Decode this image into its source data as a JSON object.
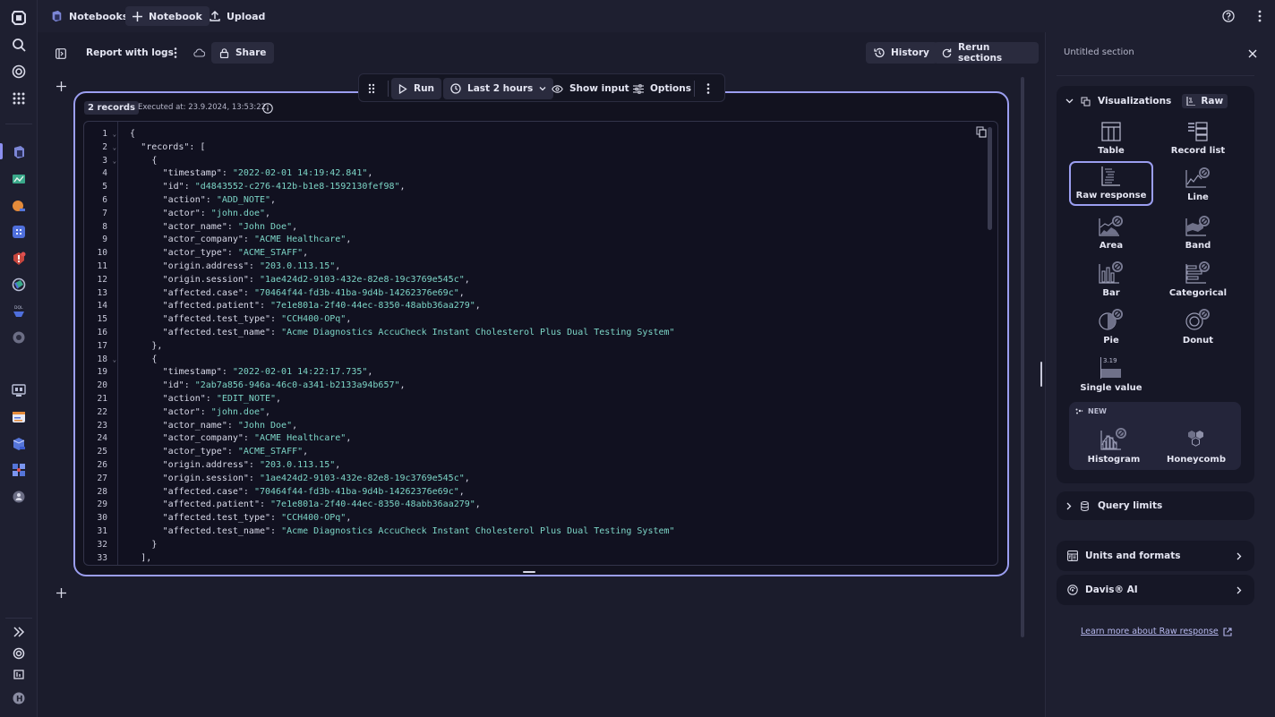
{
  "topbar": {
    "app_name": "Notebooks",
    "new_notebook_label": "Notebook",
    "upload_label": "Upload"
  },
  "notebook": {
    "title": "Report with logs",
    "share_label": "Share",
    "history_label": "History",
    "rerun_label": "Rerun sections"
  },
  "section_toolbar": {
    "run_label": "Run",
    "timeframe_label": "Last 2 hours",
    "show_input_label": "Show input",
    "options_label": "Options"
  },
  "result": {
    "records_badge": "2 records",
    "executed_at": "Executed at: 23.9.2024, 13:53:22"
  },
  "code_lines": [
    {
      "n": "1",
      "fold": true,
      "indent": 0,
      "parts": [
        [
          "p",
          "{"
        ]
      ]
    },
    {
      "n": "2",
      "fold": true,
      "indent": 1,
      "parts": [
        [
          "k",
          "\"records\""
        ],
        [
          "p",
          ": ["
        ]
      ]
    },
    {
      "n": "3",
      "fold": true,
      "indent": 2,
      "parts": [
        [
          "p",
          "{"
        ]
      ]
    },
    {
      "n": "4",
      "indent": 3,
      "parts": [
        [
          "k",
          "\"timestamp\""
        ],
        [
          "p",
          ": "
        ],
        [
          "s",
          "\"2022-02-01 14:19:42.841\""
        ],
        [
          "p",
          ","
        ]
      ]
    },
    {
      "n": "5",
      "indent": 3,
      "parts": [
        [
          "k",
          "\"id\""
        ],
        [
          "p",
          ": "
        ],
        [
          "s",
          "\"d4843552-c276-412b-b1e8-1592130fef98\""
        ],
        [
          "p",
          ","
        ]
      ]
    },
    {
      "n": "6",
      "indent": 3,
      "parts": [
        [
          "k",
          "\"action\""
        ],
        [
          "p",
          ": "
        ],
        [
          "s",
          "\"ADD_NOTE\""
        ],
        [
          "p",
          ","
        ]
      ]
    },
    {
      "n": "7",
      "indent": 3,
      "parts": [
        [
          "k",
          "\"actor\""
        ],
        [
          "p",
          ": "
        ],
        [
          "s",
          "\"john.doe\""
        ],
        [
          "p",
          ","
        ]
      ]
    },
    {
      "n": "8",
      "indent": 3,
      "parts": [
        [
          "k",
          "\"actor_name\""
        ],
        [
          "p",
          ": "
        ],
        [
          "s",
          "\"John Doe\""
        ],
        [
          "p",
          ","
        ]
      ]
    },
    {
      "n": "9",
      "indent": 3,
      "parts": [
        [
          "k",
          "\"actor_company\""
        ],
        [
          "p",
          ": "
        ],
        [
          "s",
          "\"ACME Healthcare\""
        ],
        [
          "p",
          ","
        ]
      ]
    },
    {
      "n": "10",
      "indent": 3,
      "parts": [
        [
          "k",
          "\"actor_type\""
        ],
        [
          "p",
          ": "
        ],
        [
          "s",
          "\"ACME_STAFF\""
        ],
        [
          "p",
          ","
        ]
      ]
    },
    {
      "n": "11",
      "indent": 3,
      "parts": [
        [
          "k",
          "\"origin.address\""
        ],
        [
          "p",
          ": "
        ],
        [
          "s",
          "\"203.0.113.15\""
        ],
        [
          "p",
          ","
        ]
      ]
    },
    {
      "n": "12",
      "indent": 3,
      "parts": [
        [
          "k",
          "\"origin.session\""
        ],
        [
          "p",
          ": "
        ],
        [
          "s",
          "\"1ae424d2-9103-432e-82e8-19c3769e545c\""
        ],
        [
          "p",
          ","
        ]
      ]
    },
    {
      "n": "13",
      "indent": 3,
      "parts": [
        [
          "k",
          "\"affected.case\""
        ],
        [
          "p",
          ": "
        ],
        [
          "s",
          "\"70464f44-fd3b-41ba-9d4b-14262376e69c\""
        ],
        [
          "p",
          ","
        ]
      ]
    },
    {
      "n": "14",
      "indent": 3,
      "parts": [
        [
          "k",
          "\"affected.patient\""
        ],
        [
          "p",
          ": "
        ],
        [
          "s",
          "\"7e1e801a-2f40-44ec-8350-48abb36aa279\""
        ],
        [
          "p",
          ","
        ]
      ]
    },
    {
      "n": "15",
      "indent": 3,
      "parts": [
        [
          "k",
          "\"affected.test_type\""
        ],
        [
          "p",
          ": "
        ],
        [
          "s",
          "\"CCH400-OPq\""
        ],
        [
          "p",
          ","
        ]
      ]
    },
    {
      "n": "16",
      "indent": 3,
      "parts": [
        [
          "k",
          "\"affected.test_name\""
        ],
        [
          "p",
          ": "
        ],
        [
          "s",
          "\"Acme Diagnostics AccuCheck Instant Cholesterol Plus Dual Testing System\""
        ]
      ]
    },
    {
      "n": "17",
      "indent": 2,
      "parts": [
        [
          "p",
          "},"
        ]
      ]
    },
    {
      "n": "18",
      "fold": true,
      "indent": 2,
      "parts": [
        [
          "p",
          "{"
        ]
      ]
    },
    {
      "n": "19",
      "indent": 3,
      "parts": [
        [
          "k",
          "\"timestamp\""
        ],
        [
          "p",
          ": "
        ],
        [
          "s",
          "\"2022-02-01 14:22:17.735\""
        ],
        [
          "p",
          ","
        ]
      ]
    },
    {
      "n": "20",
      "indent": 3,
      "parts": [
        [
          "k",
          "\"id\""
        ],
        [
          "p",
          ": "
        ],
        [
          "s",
          "\"2ab7a856-946a-46c0-a341-b2133a94b657\""
        ],
        [
          "p",
          ","
        ]
      ]
    },
    {
      "n": "21",
      "indent": 3,
      "parts": [
        [
          "k",
          "\"action\""
        ],
        [
          "p",
          ": "
        ],
        [
          "s",
          "\"EDIT_NOTE\""
        ],
        [
          "p",
          ","
        ]
      ]
    },
    {
      "n": "22",
      "indent": 3,
      "parts": [
        [
          "k",
          "\"actor\""
        ],
        [
          "p",
          ": "
        ],
        [
          "s",
          "\"john.doe\""
        ],
        [
          "p",
          ","
        ]
      ]
    },
    {
      "n": "23",
      "indent": 3,
      "parts": [
        [
          "k",
          "\"actor_name\""
        ],
        [
          "p",
          ": "
        ],
        [
          "s",
          "\"John Doe\""
        ],
        [
          "p",
          ","
        ]
      ]
    },
    {
      "n": "24",
      "indent": 3,
      "parts": [
        [
          "k",
          "\"actor_company\""
        ],
        [
          "p",
          ": "
        ],
        [
          "s",
          "\"ACME Healthcare\""
        ],
        [
          "p",
          ","
        ]
      ]
    },
    {
      "n": "25",
      "indent": 3,
      "parts": [
        [
          "k",
          "\"actor_type\""
        ],
        [
          "p",
          ": "
        ],
        [
          "s",
          "\"ACME_STAFF\""
        ],
        [
          "p",
          ","
        ]
      ]
    },
    {
      "n": "26",
      "indent": 3,
      "parts": [
        [
          "k",
          "\"origin.address\""
        ],
        [
          "p",
          ": "
        ],
        [
          "s",
          "\"203.0.113.15\""
        ],
        [
          "p",
          ","
        ]
      ]
    },
    {
      "n": "27",
      "indent": 3,
      "parts": [
        [
          "k",
          "\"origin.session\""
        ],
        [
          "p",
          ": "
        ],
        [
          "s",
          "\"1ae424d2-9103-432e-82e8-19c3769e545c\""
        ],
        [
          "p",
          ","
        ]
      ]
    },
    {
      "n": "28",
      "indent": 3,
      "parts": [
        [
          "k",
          "\"affected.case\""
        ],
        [
          "p",
          ": "
        ],
        [
          "s",
          "\"70464f44-fd3b-41ba-9d4b-14262376e69c\""
        ],
        [
          "p",
          ","
        ]
      ]
    },
    {
      "n": "29",
      "indent": 3,
      "parts": [
        [
          "k",
          "\"affected.patient\""
        ],
        [
          "p",
          ": "
        ],
        [
          "s",
          "\"7e1e801a-2f40-44ec-8350-48abb36aa279\""
        ],
        [
          "p",
          ","
        ]
      ]
    },
    {
      "n": "30",
      "indent": 3,
      "parts": [
        [
          "k",
          "\"affected.test_type\""
        ],
        [
          "p",
          ": "
        ],
        [
          "s",
          "\"CCH400-OPq\""
        ],
        [
          "p",
          ","
        ]
      ]
    },
    {
      "n": "31",
      "indent": 3,
      "parts": [
        [
          "k",
          "\"affected.test_name\""
        ],
        [
          "p",
          ": "
        ],
        [
          "s",
          "\"Acme Diagnostics AccuCheck Instant Cholesterol Plus Dual Testing System\""
        ]
      ]
    },
    {
      "n": "32",
      "indent": 2,
      "parts": [
        [
          "p",
          "}"
        ]
      ]
    },
    {
      "n": "33",
      "indent": 1,
      "parts": [
        [
          "p",
          "],"
        ]
      ]
    }
  ],
  "panel": {
    "section_title": "Untitled section",
    "visualizations_label": "Visualizations",
    "raw_badge": "Raw",
    "viz_options": [
      {
        "id": "table",
        "label": "Table",
        "disabled": false,
        "selected": false
      },
      {
        "id": "record-list",
        "label": "Record list",
        "disabled": false,
        "selected": false
      },
      {
        "id": "raw-response",
        "label": "Raw response",
        "disabled": false,
        "selected": true
      },
      {
        "id": "line",
        "label": "Line",
        "disabled": true,
        "selected": false
      },
      {
        "id": "area",
        "label": "Area",
        "disabled": true,
        "selected": false
      },
      {
        "id": "band",
        "label": "Band",
        "disabled": true,
        "selected": false
      },
      {
        "id": "bar",
        "label": "Bar",
        "disabled": true,
        "selected": false
      },
      {
        "id": "categorical",
        "label": "Categorical",
        "disabled": true,
        "selected": false
      },
      {
        "id": "pie",
        "label": "Pie",
        "disabled": true,
        "selected": false
      },
      {
        "id": "donut",
        "label": "Donut",
        "disabled": true,
        "selected": false
      },
      {
        "id": "single-value",
        "label": "Single value",
        "disabled": false,
        "selected": false,
        "sample_value": "3.19"
      }
    ],
    "new_label": "NEW",
    "new_viz_options": [
      {
        "id": "histogram",
        "label": "Histogram",
        "disabled": true
      },
      {
        "id": "honeycomb",
        "label": "Honeycomb",
        "disabled": false
      }
    ],
    "query_limits_label": "Query limits",
    "units_label": "Units and formats",
    "davis_label": "Davis® AI",
    "learn_more_label": "Learn more about Raw response"
  },
  "colors": {
    "accent": "#9b9ef0",
    "string": "#7dd6c7",
    "background": "#1b1c2c",
    "editor_bg": "#111120"
  }
}
